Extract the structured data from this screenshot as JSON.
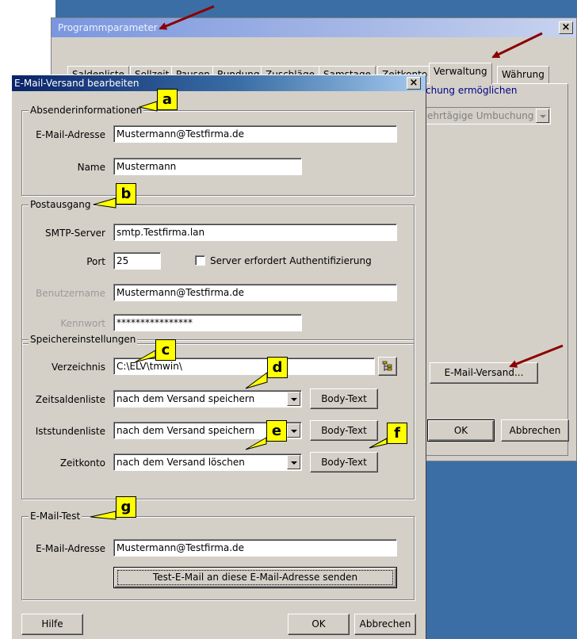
{
  "background_window": {
    "title": "Programmparameter",
    "tabs": [
      "Saldenliste",
      "Sollzeit",
      "Pausen",
      "Rundung",
      "Zuschläge",
      "Samstage",
      "Zeitkonto",
      "Verwaltung",
      "Währung"
    ],
    "active_tab": "Verwaltung",
    "partial_checkbox_label": "chung ermöglichen",
    "partial_dropdown_value": "ehrtägige Umbuchung",
    "email_button": "E-Mail-Versand...",
    "ok_button": "OK",
    "cancel_button": "Abbrechen"
  },
  "dialog": {
    "title": "E-Mail-Versand bearbeiten",
    "sender": {
      "title": "Absenderinformationen",
      "email_label": "E-Mail-Adresse",
      "email_value": "Mustermann@Testfirma.de",
      "name_label": "Name",
      "name_value": "Mustermann"
    },
    "outgoing": {
      "title": "Postausgang",
      "smtp_label": "SMTP-Server",
      "smtp_value": "smtp.Testfirma.lan",
      "port_label": "Port",
      "port_value": "25",
      "auth_label": "Server erfordert Authentifizierung",
      "user_label": "Benutzername",
      "user_value": "Mustermann@Testfirma.de",
      "password_label": "Kennwort",
      "password_value": "****************"
    },
    "storage": {
      "title": "Speichereinstellungen",
      "dir_label": "Verzeichnis",
      "dir_value": "C:\\ELV\\tmwin\\",
      "rows": [
        {
          "label": "Zeitsaldenliste",
          "value": "nach dem Versand speichern",
          "button": "Body-Text"
        },
        {
          "label": "Iststundenliste",
          "value": "nach dem Versand speichern",
          "button": "Body-Text"
        },
        {
          "label": "Zeitkonto",
          "value": "nach dem Versand löschen",
          "button": "Body-Text"
        }
      ]
    },
    "test": {
      "title": "E-Mail-Test",
      "email_label": "E-Mail-Adresse",
      "email_value": "Mustermann@Testfirma.de",
      "send_button": "Test-E-Mail an diese E-Mail-Adresse senden"
    },
    "help_button": "Hilfe",
    "ok_button": "OK",
    "cancel_button": "Abbrechen"
  },
  "callouts": [
    "a",
    "b",
    "c",
    "d",
    "e",
    "f",
    "g"
  ],
  "colors": {
    "annotation_arrow": "#8b0000",
    "callout_fill": "#ffff00",
    "desktop": "#3a6ea5",
    "dialog_face": "#d4d0c8"
  }
}
